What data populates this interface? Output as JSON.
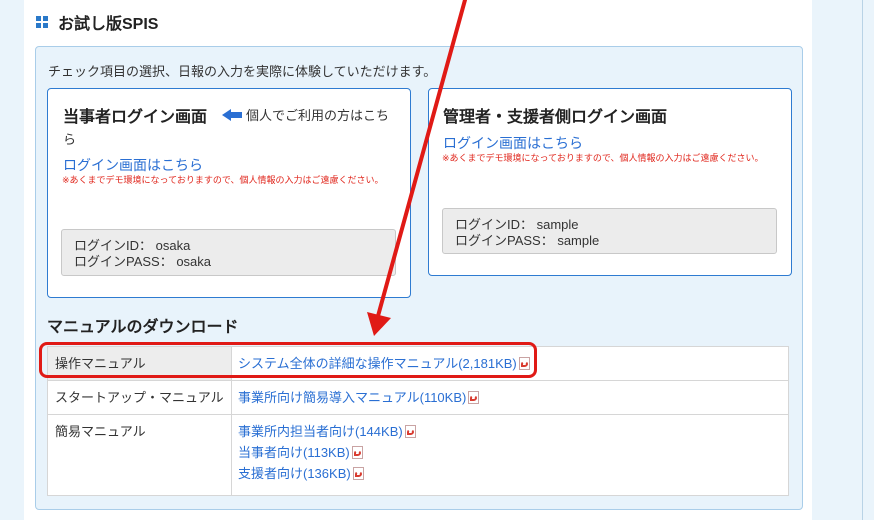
{
  "section": {
    "title": "お試し版SPIS"
  },
  "intro": "チェック項目の選択、日報の入力を実際に体験していただけます。",
  "personal_login": {
    "title": "当事者ログイン画面",
    "note_line1": "個人でご利用の方はこち",
    "note_line2": "ら",
    "link": "ログイン画面はこちら",
    "demo_note": "※あくまでデモ環境になっておりますので、個人情報の入力はご遠慮ください。",
    "cred_id": "ログインID： osaka",
    "cred_pass": "ログインPASS： osaka"
  },
  "admin_login": {
    "title": "管理者・支援者側ログイン画面",
    "link": "ログイン画面はこちら",
    "demo_note": "※あくまでデモ環境になっておりますので、個人情報の入力はご遠慮ください。",
    "cred_id": "ログインID： sample",
    "cred_pass": "ログインPASS： sample"
  },
  "manuals": {
    "heading": "マニュアルのダウンロード",
    "rows": [
      {
        "label": "操作マニュアル",
        "links": [
          "システム全体の詳細な操作マニュアル(2,181KB)"
        ]
      },
      {
        "label": "スタートアップ・マニュアル",
        "links": [
          "事業所向け簡易導入マニュアル(110KB)"
        ]
      },
      {
        "label": "簡易マニュアル",
        "links": [
          "事業所内担当者向け(144KB)",
          "当事者向け(113KB)",
          "支援者向け(136KB)"
        ]
      }
    ]
  },
  "colors": {
    "accent": "#2a6fd3",
    "annotation": "#e01a16",
    "warning_text": "#e0261c",
    "panel_bg": "#e8f3fb"
  },
  "icons": {
    "section": "grid-icon",
    "personal_note": "arrow-left-icon",
    "download": "pdf-icon"
  }
}
